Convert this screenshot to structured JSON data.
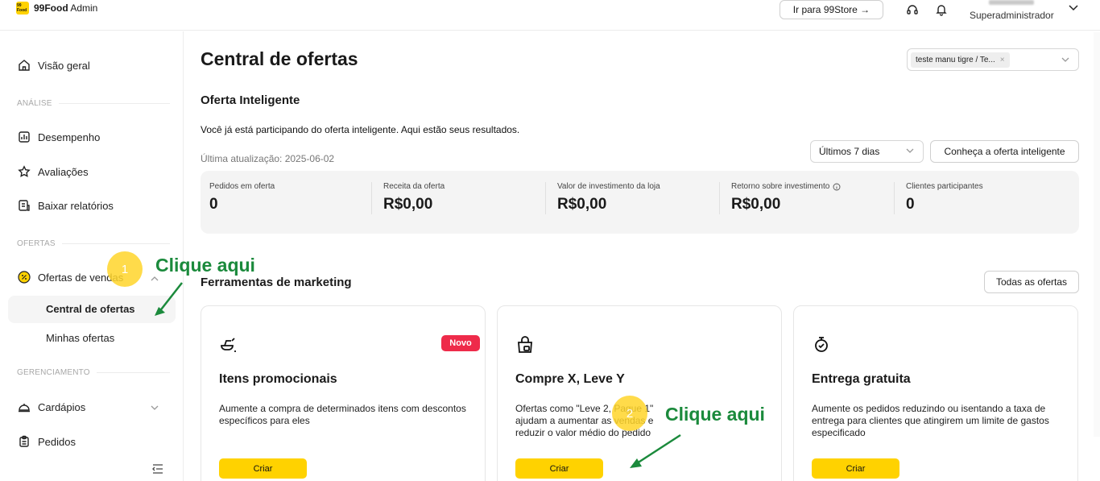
{
  "app": {
    "logo_badge": "99 Food",
    "brand": "99Food",
    "brand_suffix": "Admin",
    "store_link": "Ir para 99Store →",
    "user_role": "Superadministrador"
  },
  "sidebar": {
    "overview": "Visão geral",
    "section_analysis": "ANÁLISE",
    "performance": "Desempenho",
    "reviews": "Avaliações",
    "reports": "Baixar relatórios",
    "section_offers": "OFERTAS",
    "sales_offers": "Ofertas de vendas",
    "offers_center": "Central de ofertas",
    "my_offers": "Minhas ofertas",
    "section_management": "GERENCIAMENTO",
    "menus": "Cardápios",
    "orders": "Pedidos"
  },
  "header": {
    "title": "Central de ofertas",
    "store_tag": "teste manu tigre / Te...",
    "store_tag_close": "×"
  },
  "smart_offer": {
    "title": "Oferta Inteligente",
    "description": "Você já está participando do oferta inteligente. Aqui estão seus resultados.",
    "updated": "Última atualização: 2025-06-02",
    "period": "Últimos 7 dias",
    "know_button": "Conheça a oferta inteligente",
    "stats": [
      {
        "label": "Pedidos em oferta",
        "value": "0"
      },
      {
        "label": "Receita da oferta",
        "value": "R$0,00"
      },
      {
        "label": "Valor de investimento da loja",
        "value": "R$0,00"
      },
      {
        "label": "Retorno sobre investimento",
        "value": "R$0,00"
      },
      {
        "label": "Clientes participantes",
        "value": "0"
      }
    ]
  },
  "marketing": {
    "title": "Ferramentas de marketing",
    "all_button": "Todas as ofertas",
    "cards": [
      {
        "title": "Itens promocionais",
        "badge": "Novo",
        "description": "Aumente a compra de determinados itens com descontos específicos para eles",
        "cta": "Criar"
      },
      {
        "title": "Compre X, Leve Y",
        "description": "Ofertas como \"Leve 2, Pague 1\" ajudam a aumentar as vendas e reduzir o valor médio do pedido",
        "cta": "Criar"
      },
      {
        "title": "Entrega gratuita",
        "description": "Aumente os pedidos reduzindo ou isentando a taxa de entrega para clientes que atingirem um limite de gastos especificado",
        "cta": "Criar"
      }
    ]
  },
  "tutorial": {
    "step1": "1",
    "step2": "2",
    "hint1": "Clique aqui",
    "hint2": "Clique aqui"
  },
  "colors": {
    "accent": "#ffd200",
    "hint": "#1b8a3c",
    "badge": "#ee2b4a"
  }
}
